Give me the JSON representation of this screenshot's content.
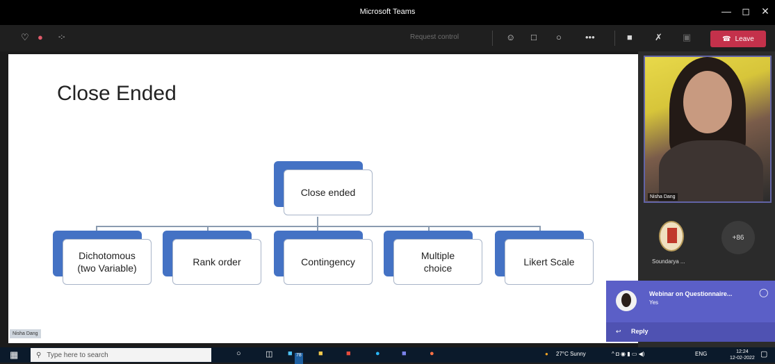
{
  "window": {
    "title": "Microsoft Teams",
    "controls": {
      "minimize": "—",
      "maximize": "◻",
      "close": "✕"
    }
  },
  "meeting_bar": {
    "timer": "-:-",
    "request_control": "Request control",
    "leave_label": "Leave",
    "colors": {
      "leave": "#c4314b",
      "accent": "#6264a7"
    }
  },
  "slide": {
    "title": "Close Ended",
    "root": "Close ended",
    "children": [
      "Dichotomous\n(two Variable)",
      "Rank order",
      "Contingency",
      "Multiple\nchoice",
      "Likert Scale"
    ],
    "presenter_tag": "Nisha Dang"
  },
  "participants": {
    "video_name": "Nisha Dang",
    "other_label": "Soundarya ...",
    "more_count": "+86"
  },
  "chat": {
    "title": "Webinar on Questionnaire...",
    "message": "Yes",
    "reply_label": "Reply"
  },
  "taskbar": {
    "search_placeholder": "Type here to search",
    "weather": "27°C  Sunny",
    "language": "ENG",
    "time": "12:24",
    "date": "12-02-2022",
    "badge": "78"
  }
}
